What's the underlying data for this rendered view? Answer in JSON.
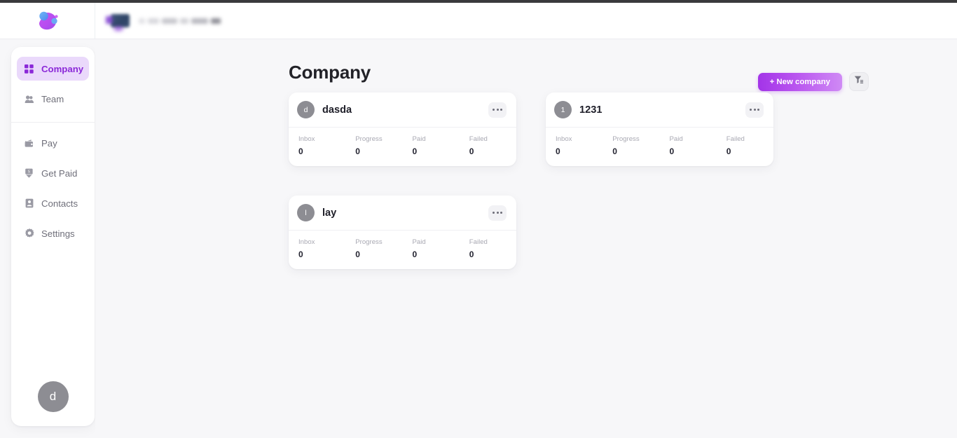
{
  "header": {
    "logo_icon": "abstract-blob-logo",
    "org_mark_icon": "org-logo-redacted",
    "org_name_redacted": "[blurred]"
  },
  "sidebar": {
    "groups": [
      {
        "items": [
          {
            "label": "Company",
            "icon": "grid-icon",
            "active": true
          },
          {
            "label": "Team",
            "icon": "people-icon",
            "active": false
          }
        ]
      },
      {
        "items": [
          {
            "label": "Pay",
            "icon": "wallet-icon",
            "active": false
          },
          {
            "label": "Get Paid",
            "icon": "money-download-icon",
            "active": false
          },
          {
            "label": "Contacts",
            "icon": "contact-card-icon",
            "active": false
          },
          {
            "label": "Settings",
            "icon": "gear-icon",
            "active": false
          }
        ]
      }
    ],
    "user_avatar_initial": "d"
  },
  "main": {
    "page_title": "Company",
    "new_company_label": "+ New company",
    "filter_icon": "filter-funnel-icon",
    "stat_labels": [
      "Inbox",
      "Progress",
      "Paid",
      "Failed"
    ],
    "menu_icon": "ellipsis-icon",
    "companies": [
      {
        "initial": "d",
        "name": "dasda",
        "stats": {
          "inbox": "0",
          "progress": "0",
          "paid": "0",
          "failed": "0"
        }
      },
      {
        "initial": "1",
        "name": "1231",
        "stats": {
          "inbox": "0",
          "progress": "0",
          "paid": "0",
          "failed": "0"
        }
      },
      {
        "initial": "l",
        "name": "lay",
        "stats": {
          "inbox": "0",
          "progress": "0",
          "paid": "0",
          "failed": "0"
        }
      }
    ]
  },
  "colors": {
    "accent": "#8b28d8",
    "accent_soft": "#ead9fb",
    "button_gradient_start": "#a334e8",
    "button_gradient_end": "#cf8af5",
    "page_bg": "#f7f7f9",
    "avatar_gray": "#8d8d93"
  }
}
